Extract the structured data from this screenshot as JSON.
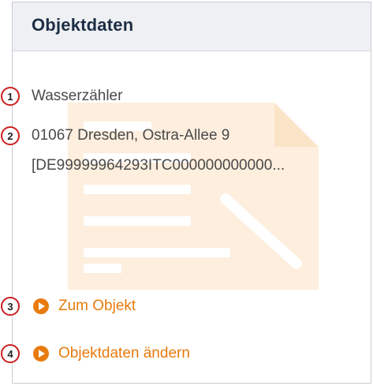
{
  "panel": {
    "title": "Objektdaten"
  },
  "object": {
    "type": "Wasserzähler",
    "address": "01067 Dresden, Ostra-Allee 9",
    "id": "[DE99999964293ITC000000000000..."
  },
  "links": [
    {
      "label": "Zum Objekt"
    },
    {
      "label": "Objektdaten ändern"
    }
  ],
  "callouts": [
    "1",
    "2",
    "3",
    "4"
  ],
  "colors": {
    "accent": "#e77b0e",
    "callout": "#cc1f1f",
    "title": "#1d2d44"
  }
}
